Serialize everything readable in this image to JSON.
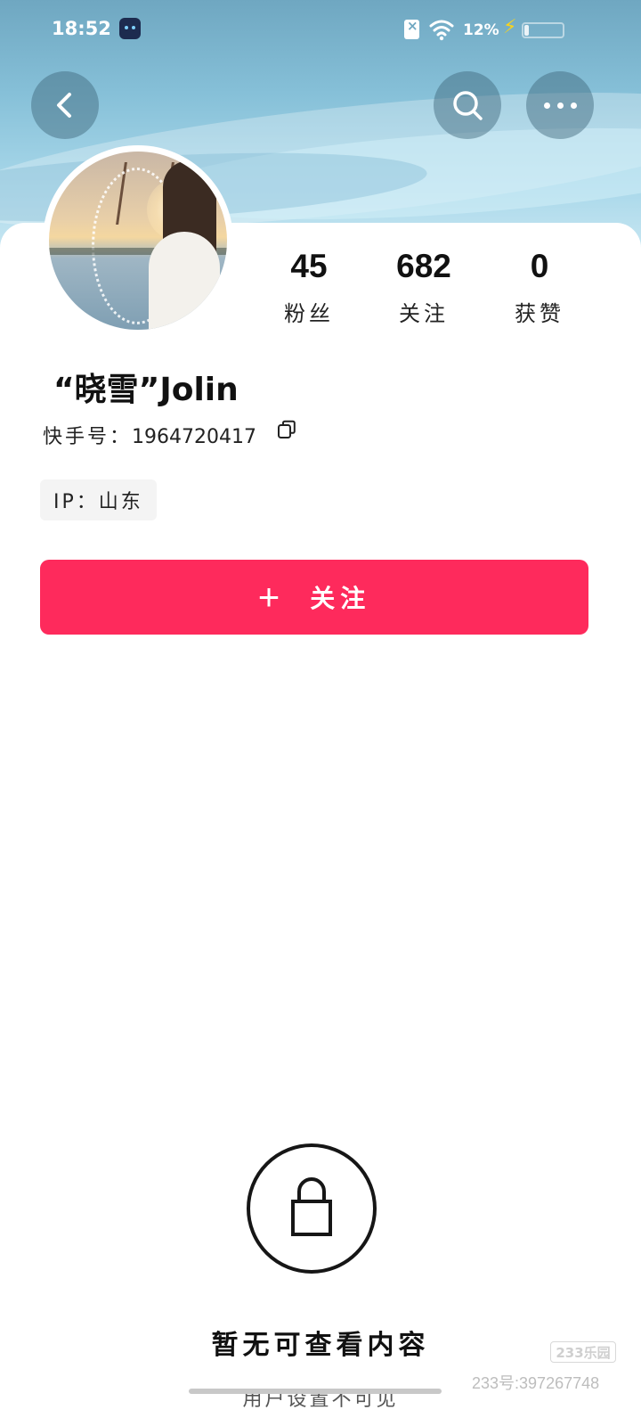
{
  "status_bar": {
    "time": "18:52",
    "battery_percent": "12%",
    "battery_level": 0.12
  },
  "icons": {
    "back": "chevron-left-icon",
    "search": "search-icon",
    "more": "more-dots-icon",
    "copy": "copy-icon",
    "lock": "lock-icon",
    "plus": "plus-icon"
  },
  "profile": {
    "name": "“晓雪”Jolin",
    "account_label": "快手号：",
    "account_id": "1964720417",
    "ip_label": "IP：山东"
  },
  "stats": [
    {
      "value": "45",
      "label": "粉丝"
    },
    {
      "value": "682",
      "label": "关注"
    },
    {
      "value": "0",
      "label": "获赞"
    }
  ],
  "follow_button": {
    "plus": "+",
    "label": "关注"
  },
  "empty_state": {
    "title": "暂无可查看内容",
    "subtitle": "用户设置不可见"
  },
  "watermark": {
    "logo": "233乐园",
    "text": "233号:397267748"
  },
  "colors": {
    "accent": "#fe2a5c",
    "header_sky": "#86c0d8"
  }
}
